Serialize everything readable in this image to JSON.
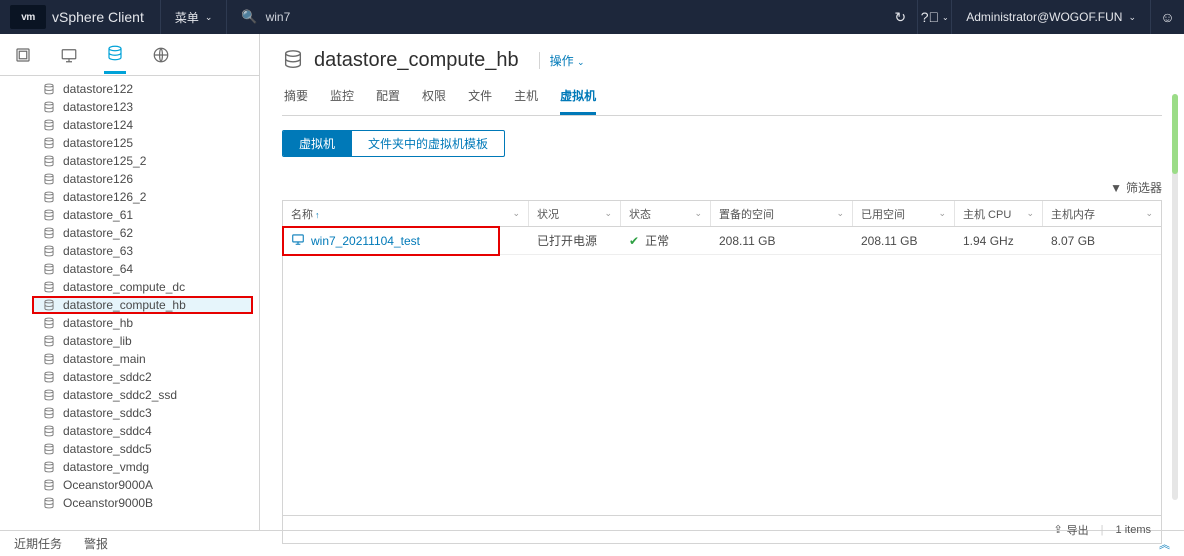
{
  "topbar": {
    "logo": "vm",
    "app_title": "vSphere Client",
    "menu_label": "菜单",
    "search_value": "win7",
    "user_label": "Administrator@WOGOF.FUN"
  },
  "sidebar": {
    "items": [
      "datastore122",
      "datastore123",
      "datastore124",
      "datastore125",
      "datastore125_2",
      "datastore126",
      "datastore126_2",
      "datastore_61",
      "datastore_62",
      "datastore_63",
      "datastore_64",
      "datastore_compute_dc",
      "datastore_compute_hb",
      "datastore_hb",
      "datastore_lib",
      "datastore_main",
      "datastore_sddc2",
      "datastore_sddc2_ssd",
      "datastore_sddc3",
      "datastore_sddc4",
      "datastore_sddc5",
      "datastore_vmdg",
      "Oceanstor9000A",
      "Oceanstor9000B"
    ],
    "selected": "datastore_compute_hb"
  },
  "main": {
    "title": "datastore_compute_hb",
    "actions_label": "操作",
    "tabs": [
      "摘要",
      "监控",
      "配置",
      "权限",
      "文件",
      "主机",
      "虚拟机"
    ],
    "active_tab": "虚拟机",
    "subtabs": [
      "虚拟机",
      "文件夹中的虚拟机模板"
    ],
    "active_subtab": "虚拟机",
    "filter_label": "筛选器",
    "columns": {
      "name": "名称",
      "status": "状况",
      "state": "状态",
      "provisioned": "置备的空间",
      "used": "已用空间",
      "cpu": "主机 CPU",
      "mem": "主机内存"
    },
    "rows": [
      {
        "name": "win7_20211104_test",
        "status": "已打开电源",
        "state": "正常",
        "provisioned": "208.11 GB",
        "used": "208.11 GB",
        "cpu": "1.94 GHz",
        "mem": "8.07 GB"
      }
    ],
    "export_label": "导出",
    "items_count": "1 items"
  },
  "bottombar": {
    "recent_tasks": "近期任务",
    "alarms": "警报"
  }
}
